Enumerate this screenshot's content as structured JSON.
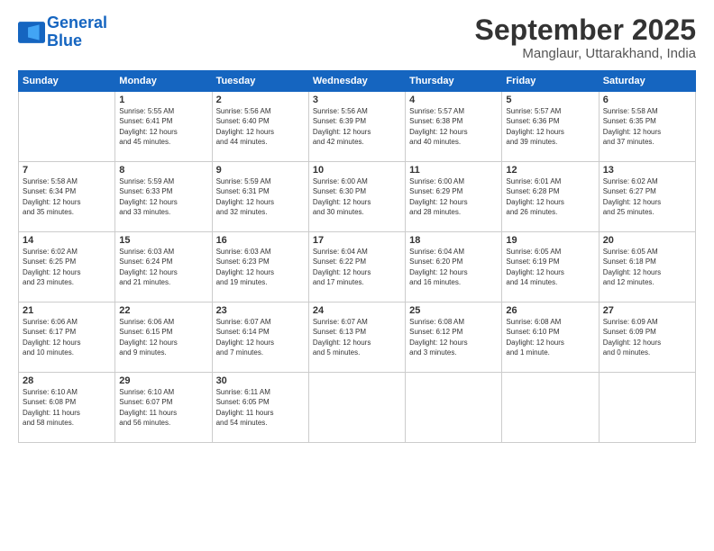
{
  "logo": {
    "line1": "General",
    "line2": "Blue"
  },
  "title": "September 2025",
  "subtitle": "Manglaur, Uttarakhand, India",
  "weekdays": [
    "Sunday",
    "Monday",
    "Tuesday",
    "Wednesday",
    "Thursday",
    "Friday",
    "Saturday"
  ],
  "weeks": [
    [
      {
        "day": "",
        "info": ""
      },
      {
        "day": "1",
        "info": "Sunrise: 5:55 AM\nSunset: 6:41 PM\nDaylight: 12 hours\nand 45 minutes."
      },
      {
        "day": "2",
        "info": "Sunrise: 5:56 AM\nSunset: 6:40 PM\nDaylight: 12 hours\nand 44 minutes."
      },
      {
        "day": "3",
        "info": "Sunrise: 5:56 AM\nSunset: 6:39 PM\nDaylight: 12 hours\nand 42 minutes."
      },
      {
        "day": "4",
        "info": "Sunrise: 5:57 AM\nSunset: 6:38 PM\nDaylight: 12 hours\nand 40 minutes."
      },
      {
        "day": "5",
        "info": "Sunrise: 5:57 AM\nSunset: 6:36 PM\nDaylight: 12 hours\nand 39 minutes."
      },
      {
        "day": "6",
        "info": "Sunrise: 5:58 AM\nSunset: 6:35 PM\nDaylight: 12 hours\nand 37 minutes."
      }
    ],
    [
      {
        "day": "7",
        "info": "Sunrise: 5:58 AM\nSunset: 6:34 PM\nDaylight: 12 hours\nand 35 minutes."
      },
      {
        "day": "8",
        "info": "Sunrise: 5:59 AM\nSunset: 6:33 PM\nDaylight: 12 hours\nand 33 minutes."
      },
      {
        "day": "9",
        "info": "Sunrise: 5:59 AM\nSunset: 6:31 PM\nDaylight: 12 hours\nand 32 minutes."
      },
      {
        "day": "10",
        "info": "Sunrise: 6:00 AM\nSunset: 6:30 PM\nDaylight: 12 hours\nand 30 minutes."
      },
      {
        "day": "11",
        "info": "Sunrise: 6:00 AM\nSunset: 6:29 PM\nDaylight: 12 hours\nand 28 minutes."
      },
      {
        "day": "12",
        "info": "Sunrise: 6:01 AM\nSunset: 6:28 PM\nDaylight: 12 hours\nand 26 minutes."
      },
      {
        "day": "13",
        "info": "Sunrise: 6:02 AM\nSunset: 6:27 PM\nDaylight: 12 hours\nand 25 minutes."
      }
    ],
    [
      {
        "day": "14",
        "info": "Sunrise: 6:02 AM\nSunset: 6:25 PM\nDaylight: 12 hours\nand 23 minutes."
      },
      {
        "day": "15",
        "info": "Sunrise: 6:03 AM\nSunset: 6:24 PM\nDaylight: 12 hours\nand 21 minutes."
      },
      {
        "day": "16",
        "info": "Sunrise: 6:03 AM\nSunset: 6:23 PM\nDaylight: 12 hours\nand 19 minutes."
      },
      {
        "day": "17",
        "info": "Sunrise: 6:04 AM\nSunset: 6:22 PM\nDaylight: 12 hours\nand 17 minutes."
      },
      {
        "day": "18",
        "info": "Sunrise: 6:04 AM\nSunset: 6:20 PM\nDaylight: 12 hours\nand 16 minutes."
      },
      {
        "day": "19",
        "info": "Sunrise: 6:05 AM\nSunset: 6:19 PM\nDaylight: 12 hours\nand 14 minutes."
      },
      {
        "day": "20",
        "info": "Sunrise: 6:05 AM\nSunset: 6:18 PM\nDaylight: 12 hours\nand 12 minutes."
      }
    ],
    [
      {
        "day": "21",
        "info": "Sunrise: 6:06 AM\nSunset: 6:17 PM\nDaylight: 12 hours\nand 10 minutes."
      },
      {
        "day": "22",
        "info": "Sunrise: 6:06 AM\nSunset: 6:15 PM\nDaylight: 12 hours\nand 9 minutes."
      },
      {
        "day": "23",
        "info": "Sunrise: 6:07 AM\nSunset: 6:14 PM\nDaylight: 12 hours\nand 7 minutes."
      },
      {
        "day": "24",
        "info": "Sunrise: 6:07 AM\nSunset: 6:13 PM\nDaylight: 12 hours\nand 5 minutes."
      },
      {
        "day": "25",
        "info": "Sunrise: 6:08 AM\nSunset: 6:12 PM\nDaylight: 12 hours\nand 3 minutes."
      },
      {
        "day": "26",
        "info": "Sunrise: 6:08 AM\nSunset: 6:10 PM\nDaylight: 12 hours\nand 1 minute."
      },
      {
        "day": "27",
        "info": "Sunrise: 6:09 AM\nSunset: 6:09 PM\nDaylight: 12 hours\nand 0 minutes."
      }
    ],
    [
      {
        "day": "28",
        "info": "Sunrise: 6:10 AM\nSunset: 6:08 PM\nDaylight: 11 hours\nand 58 minutes."
      },
      {
        "day": "29",
        "info": "Sunrise: 6:10 AM\nSunset: 6:07 PM\nDaylight: 11 hours\nand 56 minutes."
      },
      {
        "day": "30",
        "info": "Sunrise: 6:11 AM\nSunset: 6:05 PM\nDaylight: 11 hours\nand 54 minutes."
      },
      {
        "day": "",
        "info": ""
      },
      {
        "day": "",
        "info": ""
      },
      {
        "day": "",
        "info": ""
      },
      {
        "day": "",
        "info": ""
      }
    ]
  ]
}
